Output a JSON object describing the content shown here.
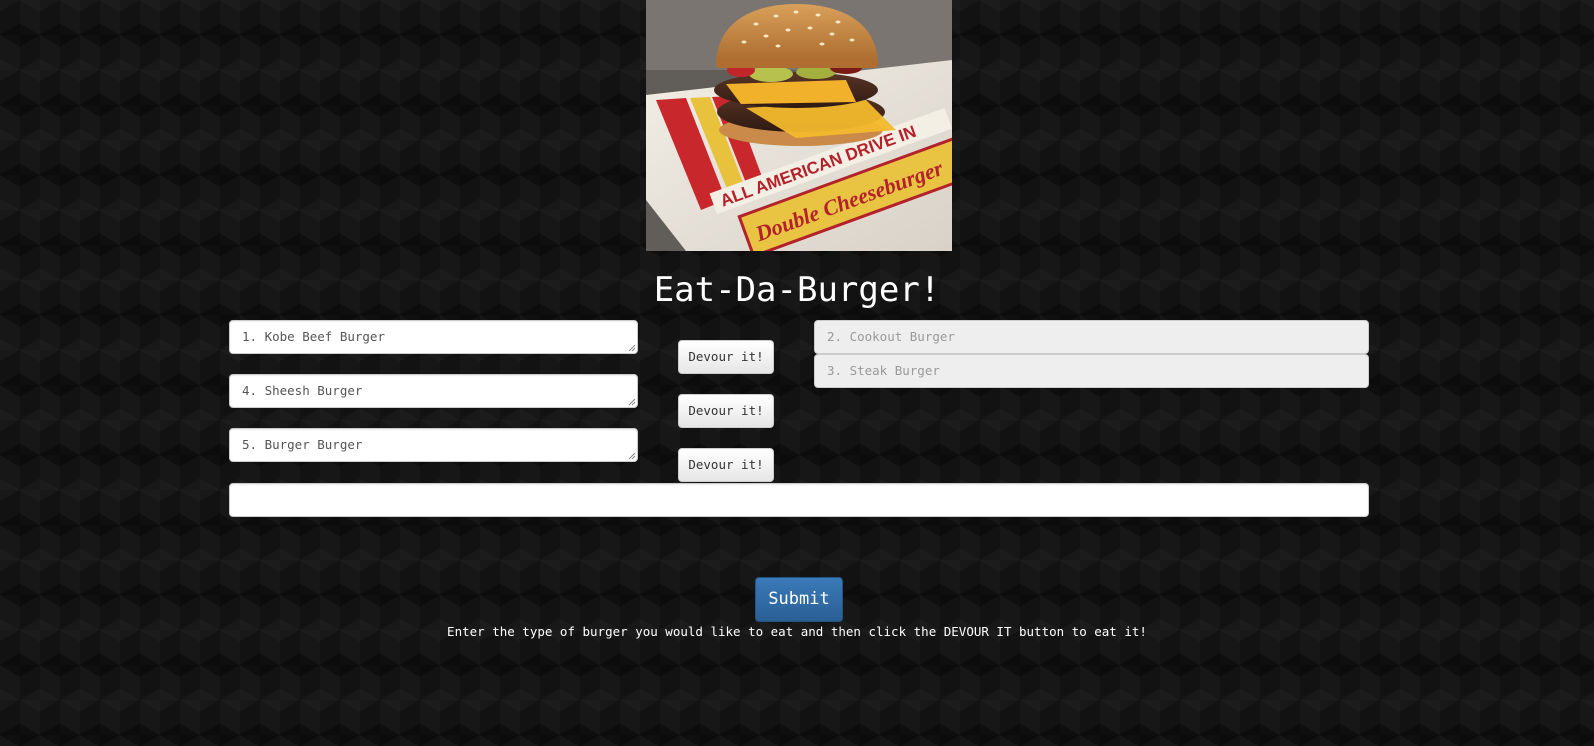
{
  "hero": {
    "wrapper_text_1": "ALL AMERICAN DRIVE IN",
    "wrapper_text_2": "Double Cheeseburger"
  },
  "title": "Eat-Da-Burger!",
  "uneaten": [
    {
      "label": "1. Kobe Beef Burger"
    },
    {
      "label": "4. Sheesh Burger"
    },
    {
      "label": "5. Burger Burger"
    }
  ],
  "devour_button_label": "Devour it!",
  "devoured": [
    {
      "label": "2. Cookout Burger"
    },
    {
      "label": "3. Steak Burger"
    }
  ],
  "new_burger": {
    "value": "",
    "placeholder": ""
  },
  "submit_label": "Submit",
  "instructions": "Enter the type of burger you would like to eat and then click the DEVOUR IT button to eat it!",
  "colors": {
    "background": "#121212",
    "submit_blue": "#2f6ba5",
    "title_text": "#ffffff"
  }
}
